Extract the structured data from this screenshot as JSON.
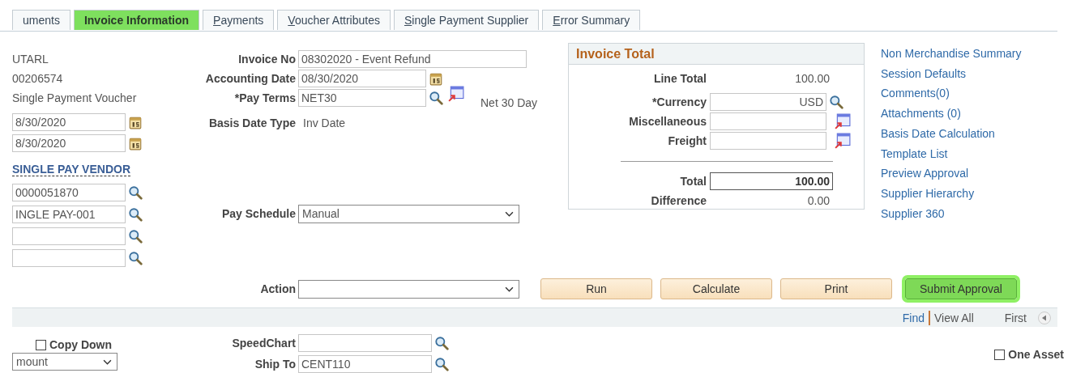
{
  "tabs": [
    {
      "label": "uments",
      "selected": false,
      "hotkey_first": false
    },
    {
      "label": "Invoice Information",
      "selected": true,
      "hotkey_first": false
    },
    {
      "label": "Payments",
      "selected": false,
      "hotkey_first": true
    },
    {
      "label": "Voucher Attributes",
      "selected": false,
      "hotkey_first": true
    },
    {
      "label": "Single Payment Supplier",
      "selected": false,
      "hotkey_first": true
    },
    {
      "label": "Error Summary",
      "selected": false,
      "hotkey_first": true
    }
  ],
  "header_left": {
    "lines": [
      "UTARL",
      "00206574",
      "Single Payment Voucher"
    ],
    "dates": [
      "8/30/2020",
      "8/30/2020"
    ],
    "vendor_link": "SINGLE PAY VENDOR",
    "lookups": [
      {
        "kind": "lookup",
        "value": "0000051870"
      },
      {
        "kind": "lookup",
        "value": "INGLE PAY-001"
      },
      {
        "kind": "lookup"
      },
      {
        "kind": "lookup"
      }
    ]
  },
  "invoice_fields": [
    {
      "label": "Invoice No",
      "kind": "text",
      "value": "08302020 - Event Refund"
    },
    {
      "label": "Accounting Date",
      "kind": "date",
      "value": "08/30/2020"
    },
    {
      "label": "*Pay Terms",
      "kind": "prompt",
      "value": "NET30",
      "description": "Net 30 Day"
    },
    {
      "label": "Basis Date Type",
      "kind": "readonly",
      "value": "Inv Date"
    },
    {
      "label": "Pay Schedule",
      "kind": "select",
      "value": "Manual"
    }
  ],
  "invoice_total": {
    "title": "Invoice Total",
    "rows": [
      {
        "label": "Line Total",
        "kind": "readonly",
        "value": "100.00"
      },
      {
        "label": "*Currency",
        "kind": "lookup",
        "value": "USD"
      },
      {
        "label": "Miscellaneous",
        "kind": "detail"
      },
      {
        "label": "Freight",
        "kind": "detail"
      },
      {
        "kind": "divider"
      },
      {
        "label": "Total",
        "kind": "total",
        "value": "100.00"
      },
      {
        "label": "Difference",
        "kind": "readonly",
        "value": "0.00"
      }
    ]
  },
  "links": [
    "Non Merchandise Summary",
    "Session Defaults",
    "Comments(0)",
    "Attachments (0)",
    "Basis Date Calculation",
    "Template List",
    "Preview Approval",
    "Supplier Hierarchy",
    "Supplier 360"
  ],
  "action": {
    "label": "Action"
  },
  "buttons": [
    {
      "label": "Run",
      "highlighted": false
    },
    {
      "label": "Calculate",
      "highlighted": false
    },
    {
      "label": "Print",
      "highlighted": false
    },
    {
      "label": "Submit Approval",
      "highlighted": true
    }
  ],
  "grid_bar": {
    "find": "Find",
    "view_all": "View All",
    "first": "First"
  },
  "lines": {
    "copy_down": {
      "label": "Copy Down",
      "checked": false
    },
    "amount_select": "mount",
    "speedchart": {
      "label": "SpeedChart"
    },
    "ship_to": {
      "label": "Ship To",
      "value": "CENT110"
    },
    "one_asset": {
      "label": "One Asset",
      "checked": false
    }
  }
}
